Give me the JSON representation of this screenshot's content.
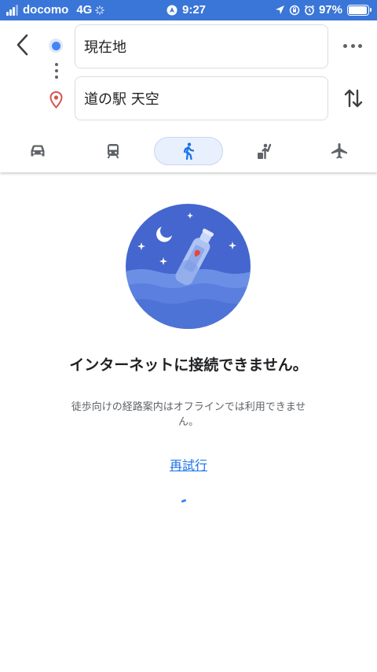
{
  "status_bar": {
    "carrier": "docomo",
    "network": "4G",
    "time": "9:27",
    "battery_percent": "97%",
    "battery_level": 0.97,
    "bar_color": "#3a76d8"
  },
  "directions": {
    "origin": "現在地",
    "destination": "道の駅 天空",
    "back_icon": "chevron-left-icon",
    "more_icon": "more-horiz-icon",
    "swap_icon": "swap-vert-icon"
  },
  "travel_modes": [
    {
      "icon": "car-icon",
      "selected": false
    },
    {
      "icon": "train-icon",
      "selected": false
    },
    {
      "icon": "walk-icon",
      "selected": true
    },
    {
      "icon": "ride-hail-icon",
      "selected": false
    },
    {
      "icon": "flight-icon",
      "selected": false
    }
  ],
  "error": {
    "title": "インターネットに接続できません。",
    "message": "徒歩向けの経路案内はオフラインでは利用できません。",
    "retry_label": "再試行",
    "illustration": "message-in-bottle"
  },
  "colors": {
    "accent": "#1a73e8",
    "origin_dot": "#4285f4",
    "destination_pin": "#d9534f",
    "active_mode_bg": "#e8f0fe"
  }
}
